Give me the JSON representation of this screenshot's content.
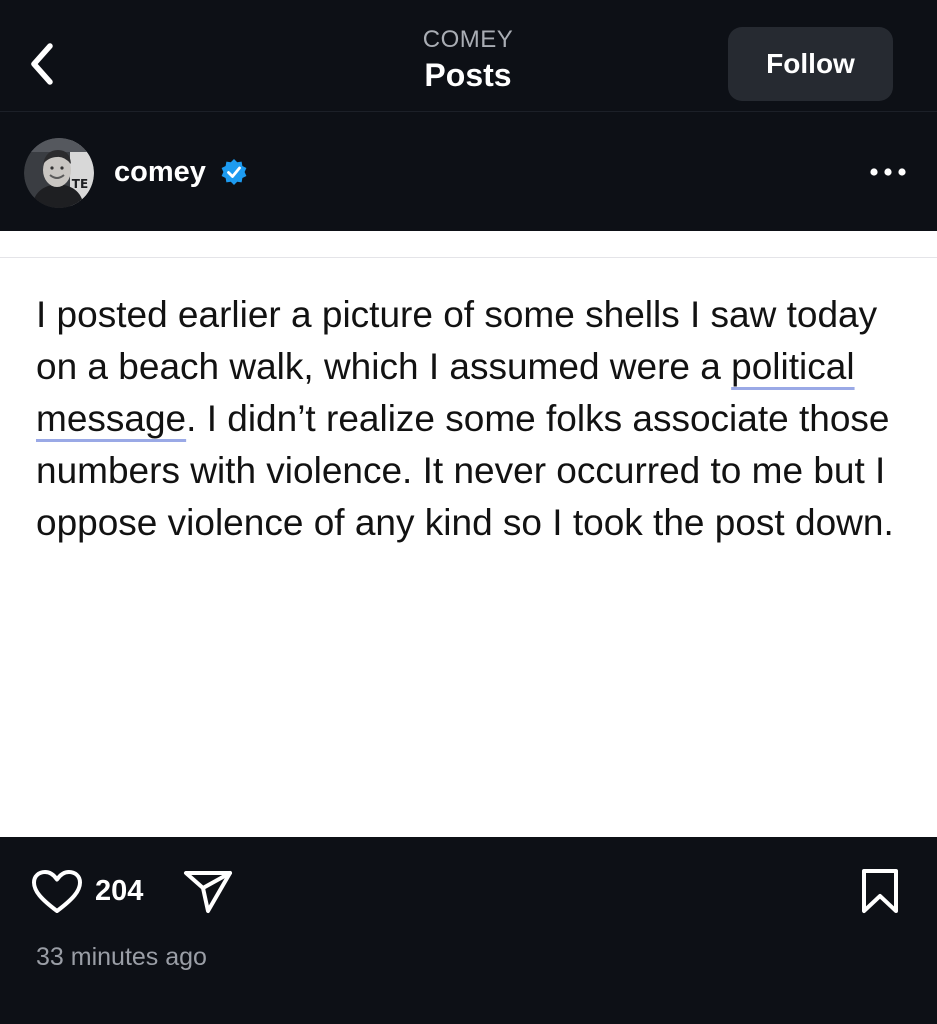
{
  "header": {
    "account_label": "COMEY",
    "title": "Posts",
    "follow_label": "Follow"
  },
  "author": {
    "username": "comey",
    "verified": true,
    "avatar_overlay_text": "TE"
  },
  "post": {
    "segments": [
      "I posted earlier a picture of some shells I saw today on a beach walk, which I assumed were a ",
      "political",
      " ",
      "message",
      ". I didn’t realize some folks associate those numbers with violence. It never occurred to me but I oppose violence of any kind so I took the post down."
    ]
  },
  "actions": {
    "like_count": "204",
    "timestamp": "33 minutes ago"
  },
  "icons": {
    "back": "chevron-left-icon",
    "verified": "verified-badge-icon",
    "more": "more-horizontal-icon",
    "like": "heart-icon",
    "share": "send-icon",
    "save": "bookmark-icon"
  },
  "colors": {
    "dark_background": "#0d1016",
    "follow_button_bg": "#262a31",
    "verified_blue": "#1d9bf0",
    "underline": "#9aa9e6",
    "muted_text": "#9a9ea6"
  }
}
